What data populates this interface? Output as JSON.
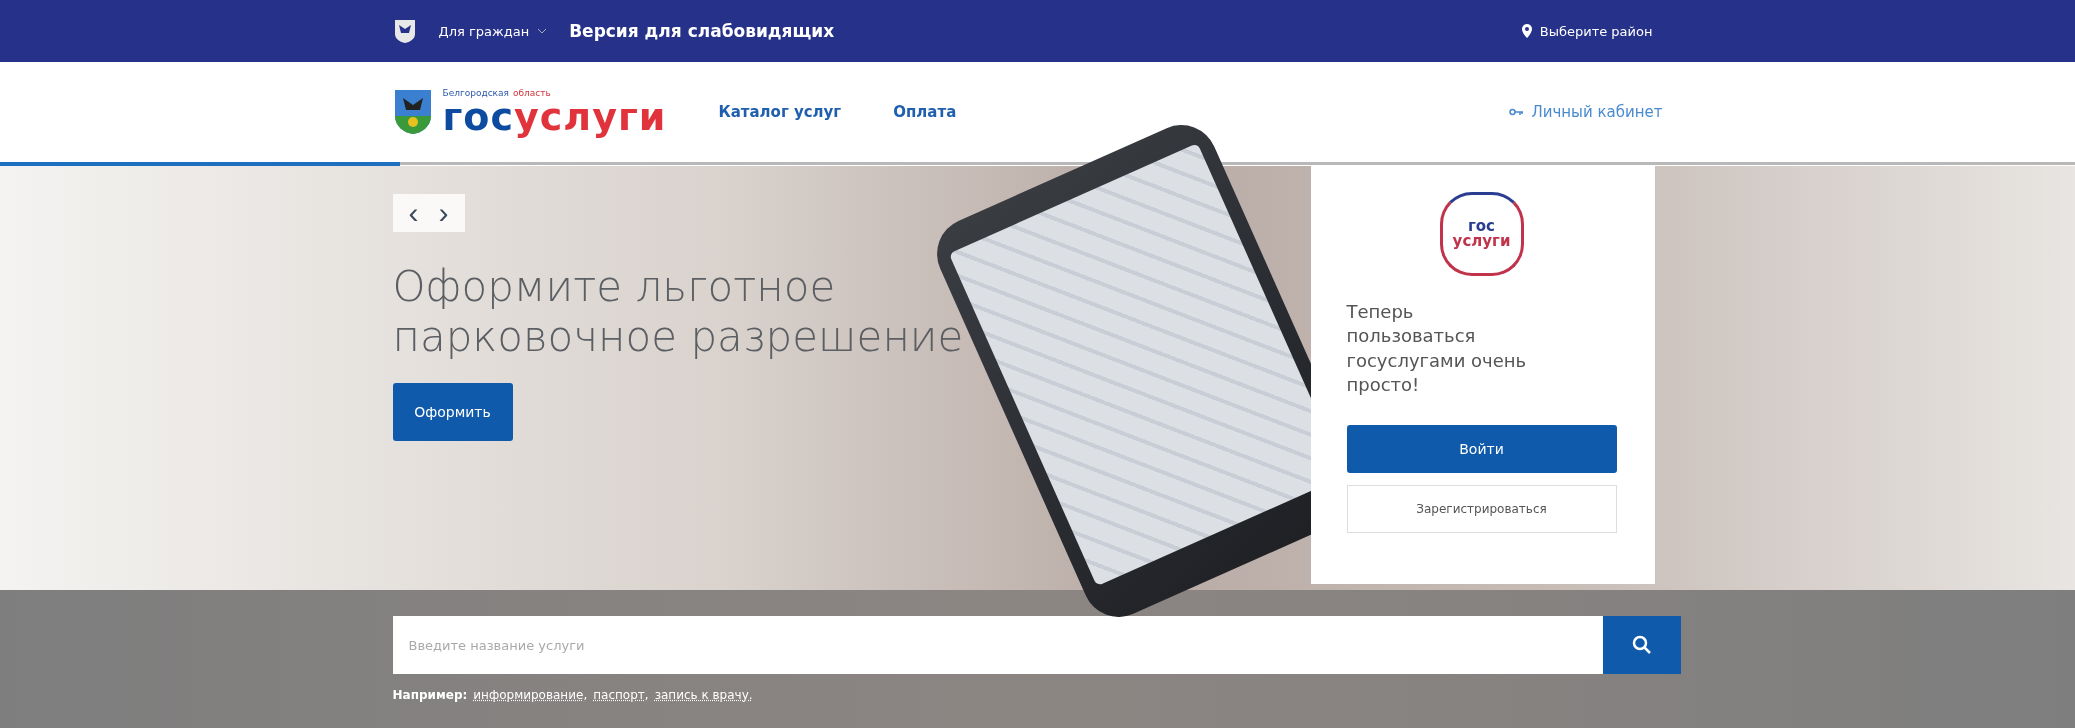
{
  "top_bar": {
    "audience_menu": "Для граждан",
    "accessibility_link": "Версия для слабовидящих",
    "region_picker": "Выберите район"
  },
  "header": {
    "logo": {
      "region_first": "Белгородская",
      "region_second": "область",
      "brand_first": "гос",
      "brand_second": "услуги"
    },
    "nav": [
      "Каталог услуг",
      "Оплата"
    ],
    "account_link": "Личный кабинет"
  },
  "hero": {
    "arrows": [
      "‹",
      "›"
    ],
    "title": "Оформите льготное парковочное разрешение",
    "action": "Оформить"
  },
  "login_card": {
    "logo_first": "гос",
    "logo_second": "услуги",
    "text": "Теперь пользоваться госуслугами очень просто!",
    "login": "Войти",
    "register": "Зарегистрироваться"
  },
  "search": {
    "placeholder": "Введите название услуги",
    "examples_label": "Например:",
    "examples": [
      "информирование,",
      "паспорт,",
      "запись к врачу."
    ]
  }
}
